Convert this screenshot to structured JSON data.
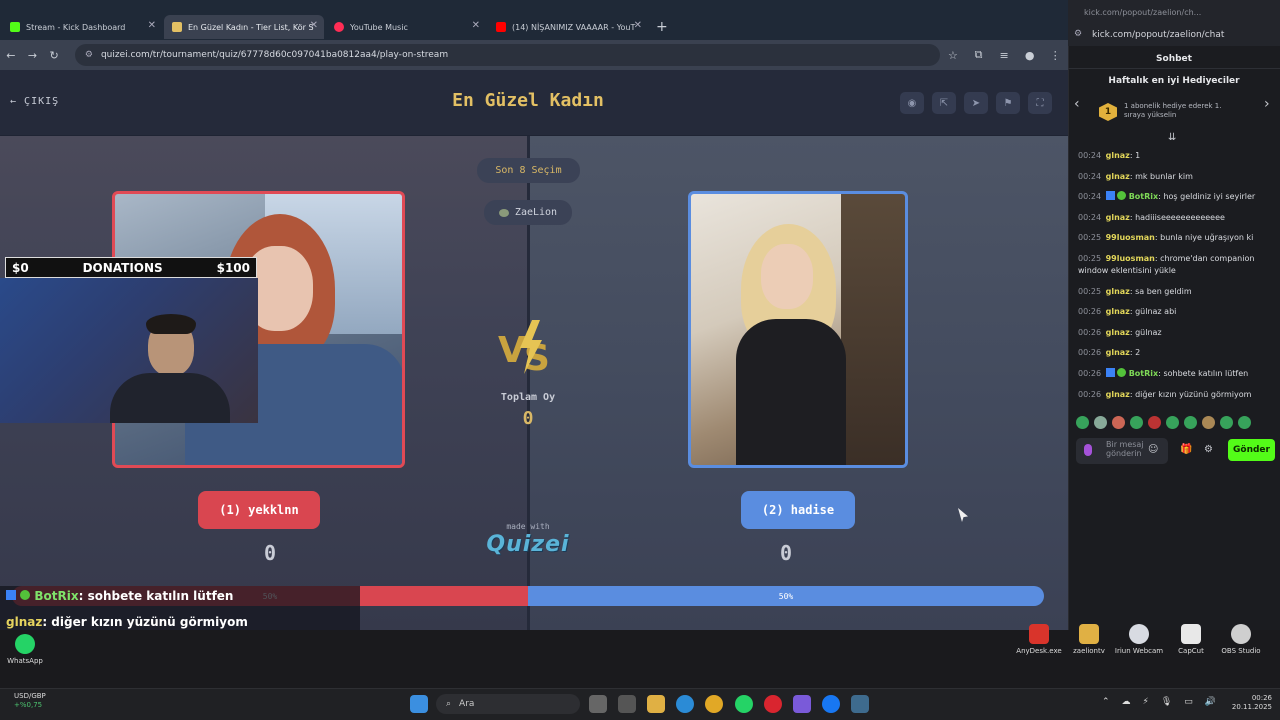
{
  "browser": {
    "tabs": [
      {
        "label": "Stream - Kick Dashboard",
        "color": "#53fc18"
      },
      {
        "label": "En Güzel Kadın - Tier List, Kör S",
        "color": "#e3c064"
      },
      {
        "label": "YouTube Music",
        "color": "#ff2d55"
      },
      {
        "label": "(14) NİŞANIMIZ VAAAAR - YouT",
        "color": "#ff0000"
      }
    ],
    "url": "quizei.com/tr/tournament/quiz/67778d60c097041ba0812aa4/play-on-stream"
  },
  "quiz": {
    "exit_label": "ÇIKIŞ",
    "title": "En Güzel Kadın",
    "last_choices": "Son 8 Seçim",
    "streamer": "ZaeLion",
    "total_label": "Toplam Oy",
    "total_value": "0",
    "option_left": {
      "label": "(1) yekklnn",
      "score": "0",
      "percent": 50,
      "percent_label": "50%"
    },
    "option_right": {
      "label": "(2) hadise",
      "score": "0",
      "percent": 50,
      "percent_label": "50%"
    },
    "made_with": "made with",
    "logo_text": "Quizei",
    "colors": {
      "left": "#d94650",
      "right": "#5a8de0",
      "gold": "#e3c064"
    }
  },
  "overlay": {
    "donations_min": "$0",
    "donations_label": "DONATIONS",
    "donations_max": "$100",
    "chat_lines": [
      {
        "user": "BotRix",
        "text": ": sohbete katılın lütfen"
      },
      {
        "user": "glnaz",
        "text": ": diğer kızın yüzünü görmiyom"
      }
    ]
  },
  "kick_chat": {
    "url_small": "kick.com/popout/zaelion/ch...",
    "url": "kick.com/popout/zaelion/chat",
    "title": "Sohbet",
    "gift_title": "Haftalık en iyi Hediyeciler",
    "gift_text": "1 abonelik hediye ederek 1. sıraya yükselin",
    "gift_rank": "1",
    "messages": [
      {
        "time": "00:24",
        "user": "glnaz",
        "text": "1",
        "style": "yellow"
      },
      {
        "time": "00:24",
        "user": "glnaz",
        "text": "mk bunlar kim",
        "style": "yellow"
      },
      {
        "time": "00:24",
        "user": "BotRix",
        "text": "hoş geldiniz iyi seyirler",
        "style": "green"
      },
      {
        "time": "00:24",
        "user": "glnaz",
        "text": "hadiiiseeeeeeeeeeeee",
        "style": "yellow"
      },
      {
        "time": "00:25",
        "user": "99luosman",
        "text": "bunla niye uğraşıyon ki",
        "style": "yellow"
      },
      {
        "time": "00:25",
        "user": "99luosman",
        "text": "chrome'dan companion window eklentisini yükle",
        "style": "yellow"
      },
      {
        "time": "00:25",
        "user": "glnaz",
        "text": "sa ben geldim",
        "style": "yellow"
      },
      {
        "time": "00:26",
        "user": "glnaz",
        "text": "gülnaz abi",
        "style": "yellow"
      },
      {
        "time": "00:26",
        "user": "glnaz",
        "text": "gülnaz",
        "style": "yellow"
      },
      {
        "time": "00:26",
        "user": "glnaz",
        "text": "2",
        "style": "yellow"
      },
      {
        "time": "00:26",
        "user": "BotRix",
        "text": "sohbete katılın lütfen",
        "style": "green"
      },
      {
        "time": "00:26",
        "user": "glnaz",
        "text": "diğer kızın yüzünü görmiyom",
        "style": "yellow"
      }
    ],
    "input_placeholder": "Bir mesaj gönderin",
    "send_label": "Gönder"
  },
  "desktop": {
    "left_icon": "WhatsApp",
    "right_icons": [
      "AnyDesk.exe",
      "zaeliontv",
      "Iriun Webcam",
      "CapCut",
      "OBS Studio"
    ]
  },
  "taskbar": {
    "ticker_name": "USD/GBP",
    "ticker_change": "+%0,75",
    "search_placeholder": "Ara",
    "time": "00:26",
    "date": "20.11.2025"
  }
}
